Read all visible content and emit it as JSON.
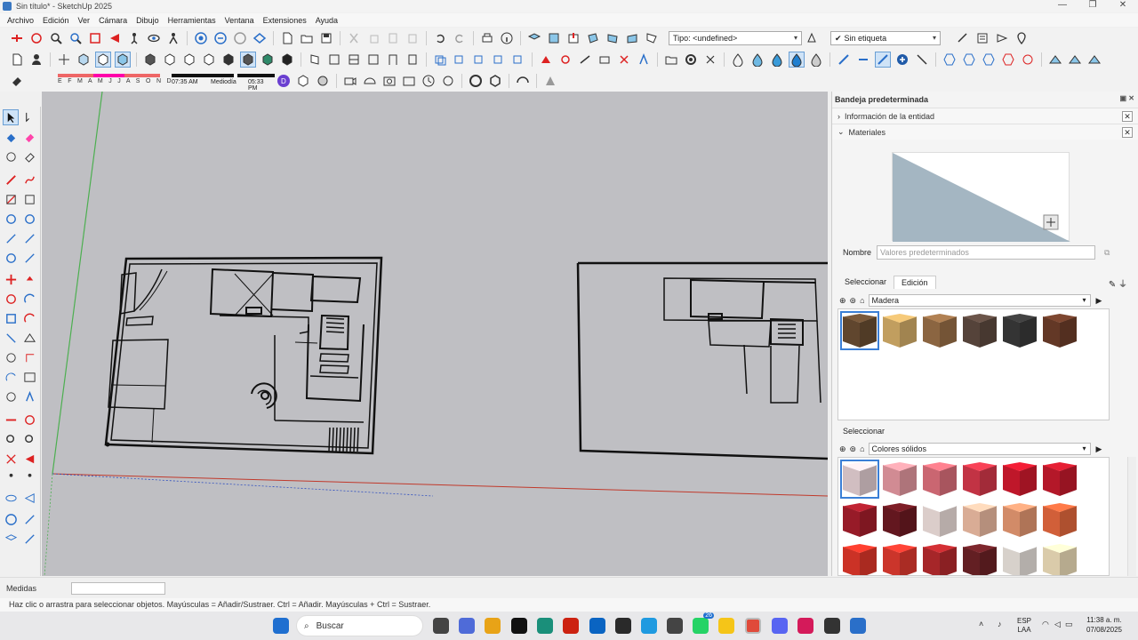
{
  "window": {
    "title": "Sin título* - SketchUp 2025"
  },
  "menu": [
    "Archivo",
    "Edición",
    "Ver",
    "Cámara",
    "Dibujo",
    "Herramientas",
    "Ventana",
    "Extensiones",
    "Ayuda"
  ],
  "toolbar": {
    "type_dropdown": "Tipo: <undefined>",
    "tag_dropdown": "Sin etiqueta"
  },
  "shadows": {
    "months": "E F M A M J J A S O N D",
    "time_start": "07:35 AM",
    "time_mid": "Mediodía",
    "time_end": "05:33 PM"
  },
  "tray": {
    "title": "Bandeja predeterminada",
    "entity_info": "Información de la entidad",
    "materials": "Materiales",
    "name_label": "Nombre",
    "name_value": "Valores predeterminados",
    "tab_select": "Seleccionar",
    "tab_edit": "Edición",
    "library_top": "Madera",
    "select_label_2": "Seleccionar",
    "library_bottom": "Colores sólidos",
    "wood_swatches": [
      "#6b4e33",
      "#d6b06a",
      "#9a7048",
      "#5e4a40",
      "#3a3a3a",
      "#6e3e2a"
    ],
    "color_swatches": [
      [
        "#e8d3d6",
        "#e89aa3",
        "#e0717d",
        "#d8394c",
        "#d41a2f",
        "#c81b2d"
      ],
      [
        "#a81e2c",
        "#6e1a22",
        "#f3e4e0",
        "#f1bfa5",
        "#e99a74",
        "#e86a3f"
      ],
      [
        "#e2382a",
        "#e23b30",
        "#b82a2e",
        "#6e2227",
        "#efe8e2",
        "#f2e2bd"
      ]
    ]
  },
  "measure": {
    "label": "Medidas"
  },
  "status": {
    "text": "Haz clic o arrastra para seleccionar objetos. Mayúsculas = Añadir/Sustraer. Ctrl = Añadir. Mayúsculas + Ctrl = Sustraer."
  },
  "taskbar": {
    "search": "Buscar",
    "lang_1": "ESP",
    "lang_2": "LAA",
    "time": "11:38 a. m.",
    "date": "07/08/2025",
    "badge": "26"
  }
}
